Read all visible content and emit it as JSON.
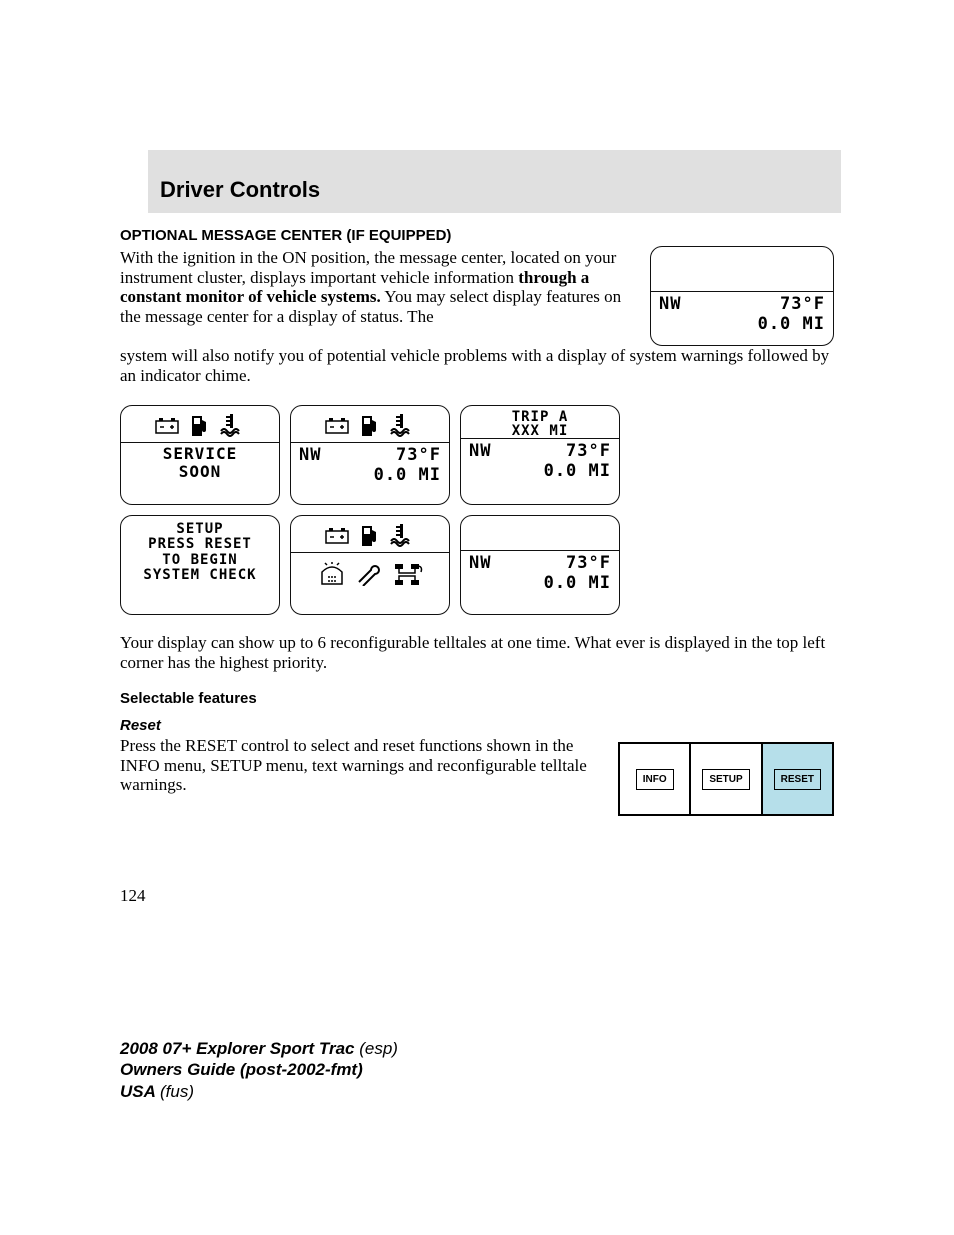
{
  "header": {
    "title": "Driver Controls"
  },
  "section": {
    "title": "OPTIONAL MESSAGE CENTER (IF EQUIPPED)"
  },
  "intro": {
    "part1": "With the ignition in the ON position, the message center, located on your instrument cluster, displays important vehicle information ",
    "bold": "through a constant monitor of vehicle systems.",
    "part2": " You may select display features on the message center for a display of status. The",
    "continuation": "system will also notify you of potential vehicle problems with a display of system warnings followed by an indicator chime."
  },
  "main_display": {
    "nw": "NW",
    "temp": "73°F",
    "mi": "0.0 MI"
  },
  "displays": [
    {
      "type": "icons_two_line",
      "line1": "SERVICE",
      "line2": "SOON"
    },
    {
      "type": "icons_status",
      "nw": "NW",
      "temp": "73°F",
      "mi": "0.0 MI"
    },
    {
      "type": "trip_status",
      "top1": "TRIP A",
      "top2": "XXX MI",
      "nw": "NW",
      "temp": "73°F",
      "mi": "0.0 MI"
    },
    {
      "type": "four_line",
      "l1": "SETUP",
      "l2": "PRESS RESET",
      "l3": "TO BEGIN",
      "l4": "SYSTEM CHECK"
    },
    {
      "type": "six_icons"
    },
    {
      "type": "blank_status",
      "nw": "NW",
      "temp": "73°F",
      "mi": "0.0 MI"
    }
  ],
  "after_grid": "Your display can show up to 6 reconfigurable telltales at one time. What ever is displayed in the top left corner has the highest priority.",
  "selectable": {
    "title": "Selectable features"
  },
  "reset": {
    "title": "Reset",
    "para": "Press the RESET control to select and reset functions shown in the INFO menu, SETUP menu, text warnings and reconfigurable telltale warnings."
  },
  "controls": {
    "info": "INFO",
    "setup": "SETUP",
    "reset": "RESET"
  },
  "page_number": "124",
  "footer": {
    "line1b": "2008 07+ Explorer Sport Trac ",
    "line1i": "(esp)",
    "line2b": "Owners Guide (post-2002-fmt)",
    "line3b": "USA ",
    "line3i": "(fus)"
  }
}
